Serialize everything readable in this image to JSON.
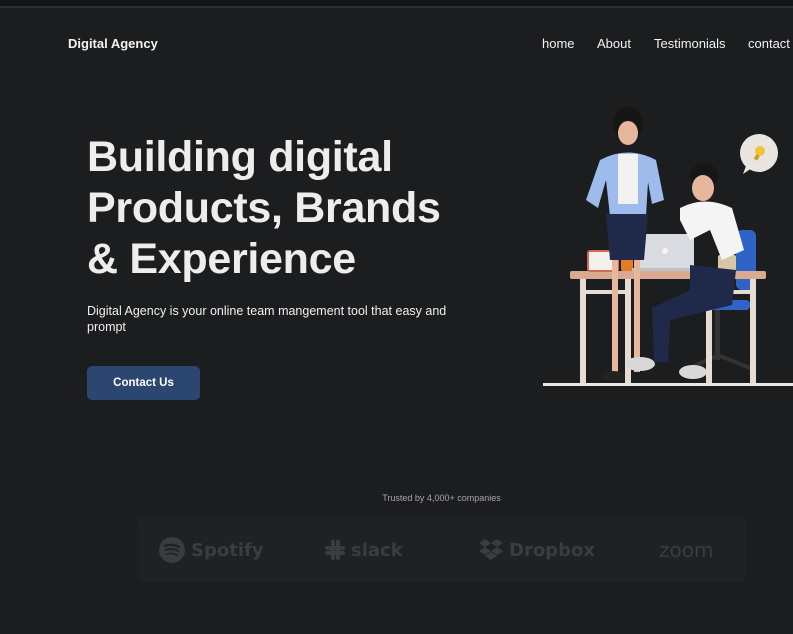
{
  "header": {
    "brand": "Digital Agency",
    "nav": [
      {
        "label": "home"
      },
      {
        "label": "About"
      },
      {
        "label": "Testimonials"
      },
      {
        "label": "contact"
      }
    ]
  },
  "hero": {
    "title_lines": [
      "Building digital",
      "Products, Brands",
      "& Experience"
    ],
    "subtitle": "Digital Agency is your online team mangement tool that easy and prompt",
    "cta_label": "Contact Us"
  },
  "trusted": {
    "caption": "Trusted by 4,000+ companies",
    "logos": [
      {
        "name": "Spotify",
        "icon": "spotify-icon"
      },
      {
        "name": "slack",
        "icon": "slack-icon"
      },
      {
        "name": "Dropbox",
        "icon": "dropbox-icon"
      },
      {
        "name": "zoom",
        "icon": "zoom-icon"
      }
    ]
  },
  "colors": {
    "background": "#1c1d1f",
    "cta": "#2b4770",
    "logo_muted": "#3a3c40"
  }
}
